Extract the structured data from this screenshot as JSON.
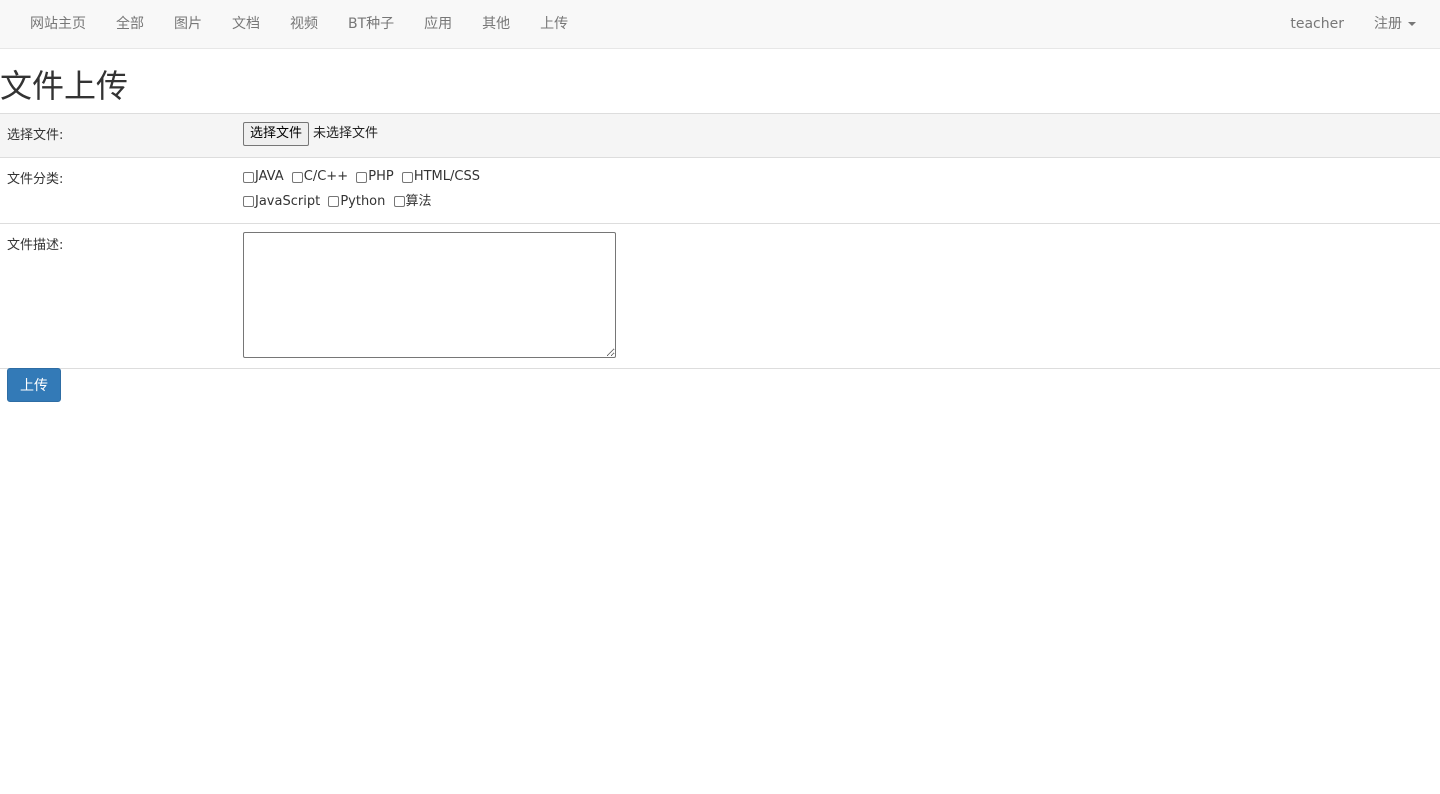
{
  "navbar": {
    "items": [
      {
        "label": "网站主页"
      },
      {
        "label": "全部"
      },
      {
        "label": "图片"
      },
      {
        "label": "文档"
      },
      {
        "label": "视频"
      },
      {
        "label": "BT种子"
      },
      {
        "label": "应用"
      },
      {
        "label": "其他"
      },
      {
        "label": "上传"
      }
    ],
    "user": "teacher",
    "register": "注册"
  },
  "page": {
    "title": "文件上传"
  },
  "form": {
    "file_label": "选择文件:",
    "file_button": "选择文件",
    "file_status": "未选择文件",
    "category_label": "文件分类:",
    "categories": [
      {
        "label": "JAVA",
        "checked": false
      },
      {
        "label": "C/C++",
        "checked": false
      },
      {
        "label": "PHP",
        "checked": false
      },
      {
        "label": "HTML/CSS",
        "checked": false
      },
      {
        "label": "JavaScript",
        "checked": false
      },
      {
        "label": "Python",
        "checked": false
      },
      {
        "label": "算法",
        "checked": false
      }
    ],
    "description_label": "文件描述:",
    "description_value": "",
    "submit": "上传"
  }
}
